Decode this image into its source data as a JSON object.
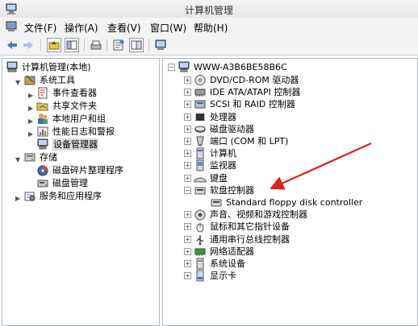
{
  "window": {
    "title": "计算机管理"
  },
  "menu": [
    {
      "id": "file",
      "label": "文件(F)"
    },
    {
      "id": "action",
      "label": "操作(A)"
    },
    {
      "id": "view",
      "label": "查看(V)"
    },
    {
      "id": "window",
      "label": "窗口(W)"
    },
    {
      "id": "help",
      "label": "帮助(H)"
    }
  ],
  "toolbar": {
    "icons": [
      "back-arrow-icon",
      "forward-arrow-icon",
      "up-folder-icon",
      "show-hide-tree-icon",
      "print-icon",
      "properties-icon",
      "help-icon",
      "console-icon"
    ]
  },
  "left_tree": {
    "root": "计算机管理(本地)",
    "system_tools": "系统工具",
    "event_viewer": "事件查看器",
    "shared_folders": "共享文件夹",
    "local_users": "本地用户和组",
    "perf_logs": "性能日志和警报",
    "device_manager": "设备管理器",
    "storage": "存储",
    "defrag": "磁盘碎片整理程序",
    "disk_mgmt": "磁盘管理",
    "services": "服务和应用程序"
  },
  "right_tree": {
    "computer": "WWW-A3B6BE58B6C",
    "items": [
      {
        "id": "dvd",
        "label": "DVD/CD-ROM 驱动器",
        "icon": "dvd-drive-icon"
      },
      {
        "id": "ide",
        "label": "IDE ATA/ATAPI 控制器",
        "icon": "ide-controller-icon"
      },
      {
        "id": "scsi",
        "label": "SCSI 和 RAID 控制器",
        "icon": "scsi-controller-icon"
      },
      {
        "id": "cpu",
        "label": "处理器",
        "icon": "processor-icon"
      },
      {
        "id": "disk",
        "label": "磁盘驱动器",
        "icon": "disk-drive-icon"
      },
      {
        "id": "ports",
        "label": "端口 (COM 和 LPT)",
        "icon": "port-icon"
      },
      {
        "id": "computer",
        "label": "计算机",
        "icon": "computer-icon"
      },
      {
        "id": "monitor",
        "label": "监视器",
        "icon": "monitor-icon"
      },
      {
        "id": "keyboard",
        "label": "键盘",
        "icon": "keyboard-icon"
      },
      {
        "id": "floppyctl",
        "label": "软盘控制器",
        "icon": "floppy-controller-icon"
      },
      {
        "id": "floppychild",
        "label": "Standard floppy disk controller",
        "icon": "floppy-controller-icon"
      },
      {
        "id": "sound",
        "label": "声音、视频和游戏控制器",
        "icon": "sound-icon"
      },
      {
        "id": "mouse",
        "label": "鼠标和其它指针设备",
        "icon": "mouse-icon"
      },
      {
        "id": "usb",
        "label": "通用串行总线控制器",
        "icon": "usb-icon"
      },
      {
        "id": "network",
        "label": "网络适配器",
        "icon": "network-adapter-icon"
      },
      {
        "id": "system",
        "label": "系统设备",
        "icon": "system-device-icon"
      },
      {
        "id": "display",
        "label": "显示卡",
        "icon": "display-adapter-icon"
      }
    ]
  },
  "colors": {
    "annotation_arrow": "#e02020",
    "selection": "#dcdcdc",
    "pane_border": "#aeb8c8"
  },
  "annotation": {
    "type": "red-arrow",
    "points_to": "软盘控制器"
  }
}
